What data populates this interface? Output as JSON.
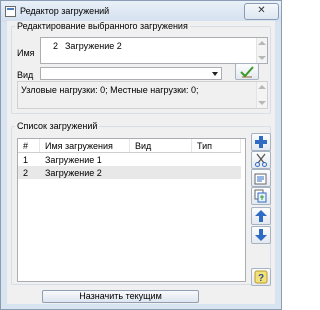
{
  "window": {
    "title": "Редактор загружений",
    "icon": "app-window-icon",
    "close_icon": "close-icon"
  },
  "edit_group": {
    "legend": "Редактирование выбранного загружения",
    "name_label": "Имя",
    "number": "2",
    "name_value": "Загружение 2",
    "type_label": "Вид",
    "type_value": "",
    "confirm_icon": "checkmark-icon",
    "loads_info": "Узловые нагрузки: 0;  Местные нагрузки: 0;"
  },
  "list_group": {
    "legend": "Список загружений",
    "columns": [
      "#",
      "Имя загружения",
      "Вид",
      "Тип"
    ],
    "rows": [
      {
        "num": "1",
        "name": "Загружение 1",
        "type": "",
        "kind": ""
      },
      {
        "num": "2",
        "name": "Загружение 2",
        "type": "",
        "kind": ""
      }
    ],
    "selected_row": 2
  },
  "toolbar": [
    "add-icon",
    "cut-icon",
    "edit-icon",
    "copy-icon",
    "move-up-icon",
    "move-down-icon",
    "help-icon"
  ],
  "set_current_button": "Назначить текущим",
  "colors": {
    "window_frame": "#d9e4f1",
    "client_bg": "#f0f0f0",
    "selection": "#e8e8e8",
    "accent_blue": "#2d6bc4",
    "confirm_green": "#3a9a2a"
  }
}
